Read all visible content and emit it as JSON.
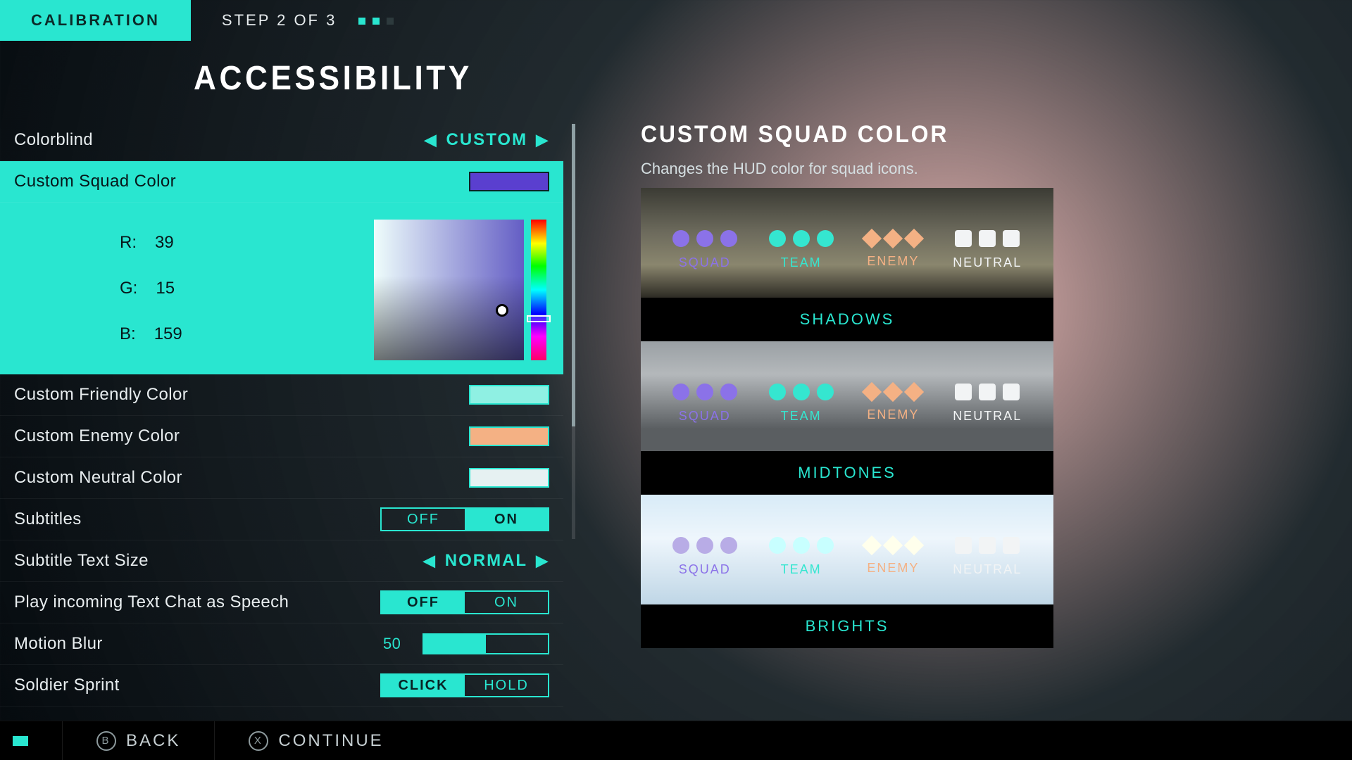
{
  "header": {
    "tab": "CALIBRATION",
    "step": "STEP 2 OF 3",
    "current_step": 2,
    "total_steps": 3
  },
  "page_title": "ACCESSIBILITY",
  "settings": {
    "colorblind": {
      "label": "Colorblind",
      "value": "CUSTOM"
    },
    "squad_color": {
      "label": "Custom Squad Color",
      "hex": "#5a3fcf",
      "r_label": "R:",
      "g_label": "G:",
      "b_label": "B:",
      "r": "39",
      "g": "15",
      "b": "159"
    },
    "friendly": {
      "label": "Custom Friendly Color",
      "hex": "#8ff0e3"
    },
    "enemy": {
      "label": "Custom Enemy Color",
      "hex": "#f4b184"
    },
    "neutral": {
      "label": "Custom Neutral Color",
      "hex": "#e6f1f2"
    },
    "subtitles": {
      "label": "Subtitles",
      "off": "OFF",
      "on": "ON",
      "value": "ON"
    },
    "subtitle_size": {
      "label": "Subtitle Text Size",
      "value": "NORMAL"
    },
    "tts": {
      "label": "Play incoming Text Chat as Speech",
      "off": "OFF",
      "on": "ON",
      "value": "OFF"
    },
    "motion_blur": {
      "label": "Motion Blur",
      "value": "50",
      "percent": 50
    },
    "sprint": {
      "label": "Soldier Sprint",
      "a": "CLICK",
      "b": "HOLD",
      "value": "CLICK"
    }
  },
  "preview": {
    "title": "CUSTOM SQUAD COLOR",
    "desc": "Changes the HUD color for squad icons.",
    "groups": {
      "squad": {
        "label": "SQUAD",
        "color": "#8b72e8"
      },
      "team": {
        "label": "TEAM",
        "color": "#35e6d0"
      },
      "enemy": {
        "label": "ENEMY",
        "color": "#f4b184"
      },
      "neutral": {
        "label": "NEUTRAL",
        "color": "#f2f4f5"
      }
    },
    "captions": {
      "shadows": "SHADOWS",
      "midtones": "MIDTONES",
      "brights": "BRIGHTS"
    }
  },
  "footer": {
    "back": "BACK",
    "back_key": "B",
    "continue": "CONTINUE",
    "continue_key": "X"
  }
}
